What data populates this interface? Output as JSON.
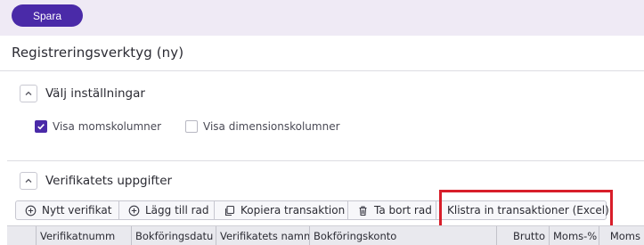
{
  "toolbar": {
    "save_label": "Spara"
  },
  "page": {
    "title": "Registreringsverktyg (ny)"
  },
  "settings": {
    "title": "Välj inställningar",
    "options": [
      {
        "label": "Visa momskolumner",
        "checked": true
      },
      {
        "label": "Visa dimensionskolumner",
        "checked": false
      }
    ]
  },
  "voucher": {
    "title": "Verifikatets uppgifter",
    "actions": [
      {
        "label": "Nytt verifikat",
        "icon": "plus-circle-icon"
      },
      {
        "label": "Lägg till rad",
        "icon": "plus-circle-icon"
      },
      {
        "label": "Kopiera transaktion",
        "icon": "copy-icon"
      },
      {
        "label": "Ta bort rad",
        "icon": "trash-icon"
      },
      {
        "label": "Klistra in transaktioner (Excel)",
        "icon": ""
      }
    ],
    "columns": [
      "",
      "Verifikatnumm",
      "Bokföringsdatu",
      "Verifikatets namn",
      "Bokföringskonto",
      "Brutto",
      "Moms-%",
      "Moms"
    ]
  },
  "colors": {
    "accent": "#4a2aa8",
    "highlight": "#d81e2a",
    "topbar": "#efeaf5"
  }
}
